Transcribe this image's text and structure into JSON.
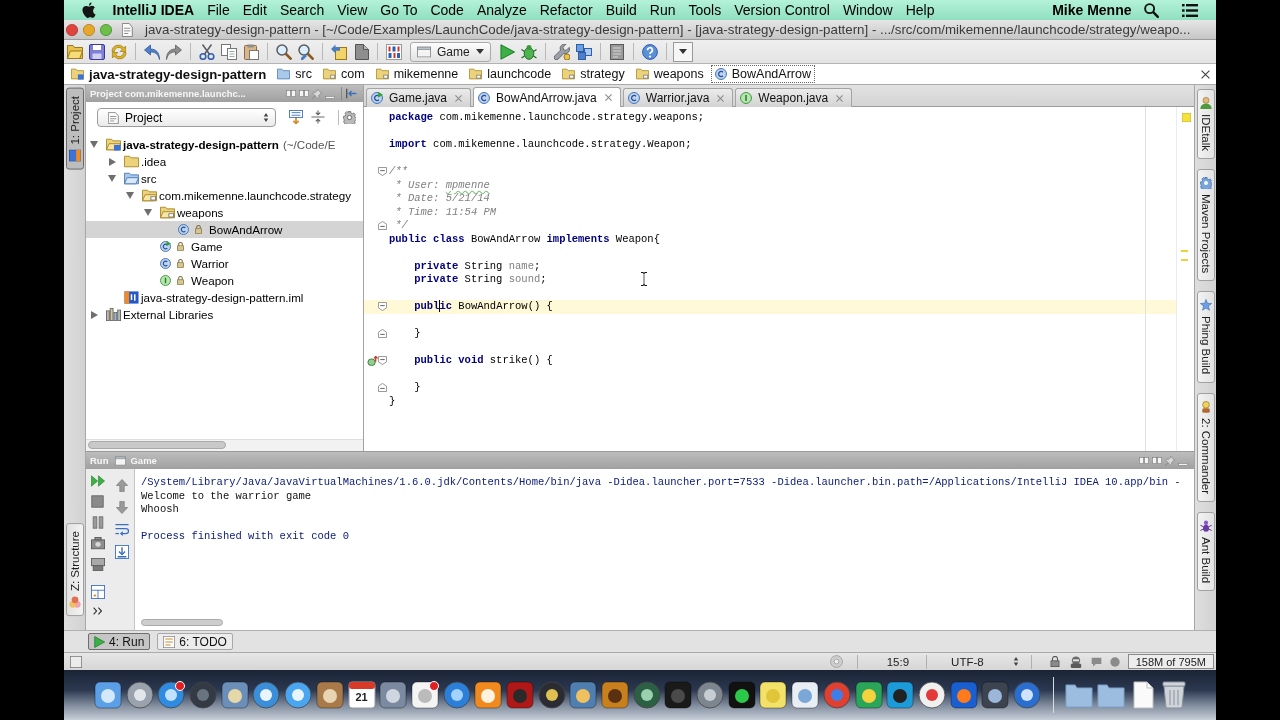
{
  "menu_bar": {
    "app_name": "IntelliJ IDEA",
    "items": [
      "File",
      "Edit",
      "Search",
      "View",
      "Go To",
      "Code",
      "Analyze",
      "Refactor",
      "Build",
      "Run",
      "Tools",
      "Version Control",
      "Window",
      "Help"
    ],
    "user": "Mike Menne"
  },
  "window": {
    "title": "java-strategy-design-pattern - [~/Code/Examples/LaunchCode/java-strategy-design-pattern] - [java-strategy-design-pattern] - .../src/com/mikemenne/launchcode/strategy/weapo..."
  },
  "toolbar": {
    "run_configuration": "Game"
  },
  "navigation_bar": [
    {
      "label": "java-strategy-design-pattern",
      "kind": "module",
      "selected": false
    },
    {
      "label": "src",
      "kind": "source",
      "selected": false
    },
    {
      "label": "com",
      "kind": "package",
      "selected": false
    },
    {
      "label": "mikemenne",
      "kind": "package",
      "selected": false
    },
    {
      "label": "launchcode",
      "kind": "package",
      "selected": false
    },
    {
      "label": "strategy",
      "kind": "package",
      "selected": false
    },
    {
      "label": "weapons",
      "kind": "package",
      "selected": false
    },
    {
      "label": "BowAndArrow",
      "kind": "class",
      "selected": true
    }
  ],
  "left_tool_strip": {
    "top": [
      {
        "label": "1: Project",
        "selected": true
      }
    ],
    "bottom": [
      {
        "label": "Z: Structure",
        "selected": false
      }
    ]
  },
  "project_panel": {
    "title": "Project com.mikemenne.launchc...",
    "view": "Project",
    "tree": [
      {
        "label": "java-strategy-design-pattern",
        "path": "(~/Code/E",
        "kind": "module",
        "expanded": true,
        "selected": false,
        "children": [
          {
            "label": ".idea",
            "kind": "folder",
            "expanded": false,
            "selected": false
          },
          {
            "label": "src",
            "kind": "source",
            "expanded": true,
            "selected": false,
            "children": [
              {
                "label": "com.mikemenne.launchcode.strategy",
                "kind": "package",
                "expanded": true,
                "selected": false,
                "children": [
                  {
                    "label": "weapons",
                    "kind": "package",
                    "expanded": true,
                    "selected": false,
                    "children": [
                      {
                        "label": "BowAndArrow",
                        "kind": "class",
                        "selected": true
                      }
                    ]
                  },
                  {
                    "label": "Game",
                    "kind": "runnable_class",
                    "selected": false
                  },
                  {
                    "label": "Warrior",
                    "kind": "class",
                    "selected": false
                  },
                  {
                    "label": "Weapon",
                    "kind": "interface",
                    "selected": false
                  }
                ]
              }
            ]
          },
          {
            "label": "java-strategy-design-pattern.iml",
            "kind": "module_file",
            "selected": false
          }
        ]
      },
      {
        "label": "External Libraries",
        "kind": "library",
        "expanded": false,
        "selected": false
      }
    ]
  },
  "editor": {
    "tabs": [
      {
        "label": "Game.java",
        "kind": "runnable_class",
        "selected": false
      },
      {
        "label": "BowAndArrow.java",
        "kind": "class",
        "selected": true
      },
      {
        "label": "Warrior.java",
        "kind": "class",
        "selected": false
      },
      {
        "label": "Weapon.java",
        "kind": "interface",
        "selected": false
      }
    ],
    "lines": [
      {
        "current": false,
        "fold_start": false,
        "fold_end": false,
        "implements_marker": false,
        "tokens": [
          {
            "text": "package",
            "kind": "keyword"
          },
          {
            "text": " com.mikemenne.launchcode.strategy.weapons;",
            "kind": "plain"
          }
        ]
      },
      {
        "current": false,
        "fold_start": false,
        "fold_end": false,
        "implements_marker": false
      },
      {
        "current": false,
        "fold_start": false,
        "fold_end": false,
        "implements_marker": false,
        "tokens": [
          {
            "text": "import",
            "kind": "keyword"
          },
          {
            "text": " com.mikemenne.launchcode.strategy.Weapon;",
            "kind": "plain"
          }
        ]
      },
      {
        "current": false,
        "fold_start": false,
        "fold_end": false,
        "implements_marker": false
      },
      {
        "current": false,
        "fold_start": true,
        "fold_end": false,
        "implements_marker": false,
        "tokens": [
          {
            "text": "/**",
            "kind": "comment"
          }
        ]
      },
      {
        "current": false,
        "fold_start": false,
        "fold_end": false,
        "implements_marker": false,
        "tokens": [
          {
            "text": " * User: ",
            "kind": "comment"
          },
          {
            "text": "mpmenne",
            "kind": "typo"
          }
        ]
      },
      {
        "current": false,
        "fold_start": false,
        "fold_end": false,
        "implements_marker": false,
        "tokens": [
          {
            "text": " * Date: 5/21/14",
            "kind": "comment"
          }
        ]
      },
      {
        "current": false,
        "fold_start": false,
        "fold_end": false,
        "implements_marker": false,
        "tokens": [
          {
            "text": " * Time: 11:54 PM",
            "kind": "comment"
          }
        ]
      },
      {
        "current": false,
        "fold_start": false,
        "fold_end": true,
        "implements_marker": false,
        "tokens": [
          {
            "text": " */",
            "kind": "comment"
          }
        ]
      },
      {
        "current": false,
        "fold_start": false,
        "fold_end": false,
        "implements_marker": false,
        "tokens": [
          {
            "text": "public class",
            "kind": "keyword"
          },
          {
            "text": " BowAndArrow ",
            "kind": "plain"
          },
          {
            "text": "implements",
            "kind": "keyword"
          },
          {
            "text": " Weapon{",
            "kind": "plain"
          }
        ]
      },
      {
        "current": false,
        "fold_start": false,
        "fold_end": false,
        "implements_marker": false
      },
      {
        "current": false,
        "fold_start": false,
        "fold_end": false,
        "implements_marker": false,
        "tokens": [
          {
            "text": "    private",
            "kind": "keyword"
          },
          {
            "text": " String ",
            "kind": "plain"
          },
          {
            "text": "name",
            "kind": "unused"
          },
          {
            "text": ";",
            "kind": "plain"
          }
        ]
      },
      {
        "current": false,
        "fold_start": false,
        "fold_end": false,
        "implements_marker": false,
        "tokens": [
          {
            "text": "    private",
            "kind": "keyword"
          },
          {
            "text": " String ",
            "kind": "plain"
          },
          {
            "text": "sound",
            "kind": "unused"
          },
          {
            "text": ";",
            "kind": "plain"
          }
        ]
      },
      {
        "current": false,
        "fold_start": false,
        "fold_end": false,
        "implements_marker": false
      },
      {
        "current": true,
        "fold_start": true,
        "fold_end": false,
        "implements_marker": false,
        "tokens": [
          {
            "text": "    publ",
            "kind": "keyword",
            "caret": true
          },
          {
            "text": "ic",
            "kind": "keyword"
          },
          {
            "text": " BowAndArrow() {",
            "kind": "plain"
          }
        ]
      },
      {
        "current": false,
        "fold_start": false,
        "fold_end": false,
        "implements_marker": false
      },
      {
        "current": false,
        "fold_start": false,
        "fold_end": true,
        "implements_marker": false,
        "tokens": [
          {
            "text": "    }",
            "kind": "plain"
          }
        ]
      },
      {
        "current": false,
        "fold_start": false,
        "fold_end": false,
        "implements_marker": false
      },
      {
        "current": false,
        "fold_start": true,
        "fold_end": false,
        "implements_marker": true,
        "tokens": [
          {
            "text": "    public void",
            "kind": "keyword"
          },
          {
            "text": " strike() {",
            "kind": "plain"
          }
        ]
      },
      {
        "current": false,
        "fold_start": false,
        "fold_end": false,
        "implements_marker": false
      },
      {
        "current": false,
        "fold_start": false,
        "fold_end": true,
        "implements_marker": false,
        "tokens": [
          {
            "text": "    }",
            "kind": "plain"
          }
        ]
      },
      {
        "current": false,
        "fold_start": false,
        "fold_end": false,
        "implements_marker": false,
        "tokens": [
          {
            "text": "}",
            "kind": "plain"
          }
        ]
      }
    ]
  },
  "right_tool_strip": [
    {
      "label": "IDEtalk",
      "selected": false
    },
    {
      "label": "Maven Projects",
      "selected": false
    },
    {
      "label": "Phing Build",
      "selected": false
    },
    {
      "label": "2: Commander",
      "selected": false
    },
    {
      "label": "Ant Build",
      "selected": false
    }
  ],
  "run_panel": {
    "title": "Run",
    "tab": "Game",
    "output": [
      {
        "text": "/System/Library/Java/JavaVirtualMachines/1.6.0.jdk/Contents/Home/bin/java -Didea.launcher.port=7533 -Didea.launcher.bin.path=/Applications/IntelliJ IDEA 10.app/bin -",
        "kind": "system"
      },
      {
        "text": "Welcome to the warrior game",
        "kind": "stdout"
      },
      {
        "text": "Whoosh",
        "kind": "stdout"
      },
      {
        "kind": "blank"
      },
      {
        "text": "Process finished with exit code 0",
        "kind": "system"
      }
    ]
  },
  "tool_window_buttons": [
    {
      "label": "4: Run",
      "selected": true
    },
    {
      "label": "6: TODO",
      "selected": false
    }
  ],
  "status_bar": {
    "caret_position": "15:9",
    "encoding": "UTF-8",
    "memory": "158M of 795M"
  },
  "dock": {
    "calendar_date": "21"
  }
}
